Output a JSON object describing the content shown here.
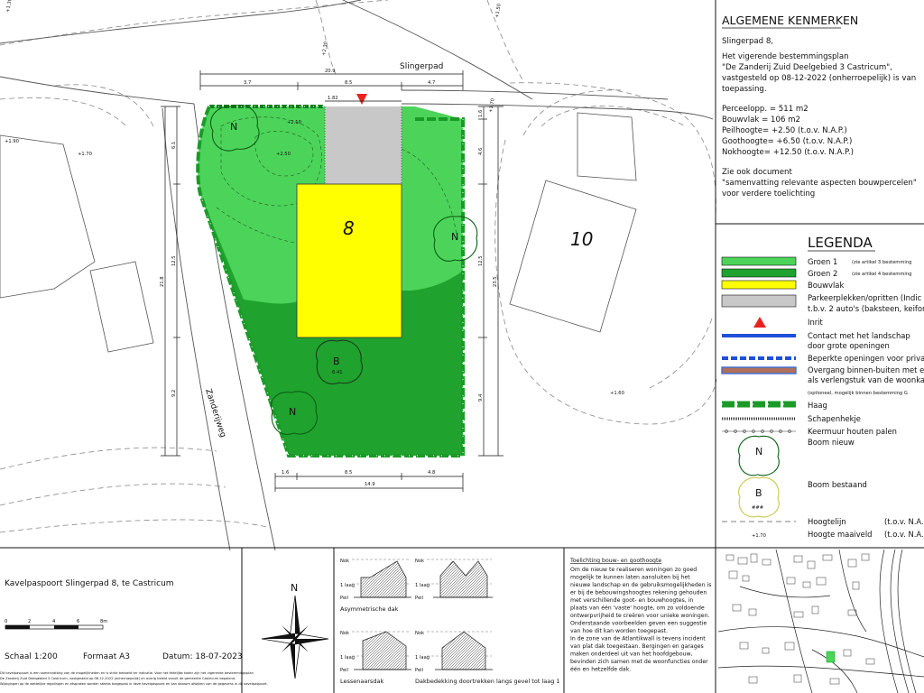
{
  "plan": {
    "street_label": "Slingerpad",
    "road_label": "Zanderijweg",
    "plot_number": "8",
    "neighbor_number": "10",
    "tree_new_letter": "N",
    "tree_existing_letter": "B",
    "tree_existing_height": "6.41",
    "dims_top": [
      "20.9",
      "3.7",
      "8.5",
      "4.7"
    ],
    "dim_182": "1.82",
    "dims_bottom": [
      "1.6",
      "8.5",
      "4.8",
      "14.9"
    ],
    "dims_left": [
      "6.1",
      "12.5",
      "21.8",
      "9.2"
    ],
    "dims_right": [
      "1.6",
      "4.6",
      "12.5",
      "23.5",
      "9.4"
    ],
    "contour_labels": [
      "+2.10",
      "+2.50"
    ],
    "spot_heights": [
      "+1.90",
      "+1.70",
      "+1.60"
    ],
    "rotated_heights": [
      "+1.30",
      "+2.30",
      "+1.50",
      "+1.70"
    ]
  },
  "kenmerken": {
    "title": "ALGEMENE KENMERKEN",
    "address": "Slingerpad 8,",
    "plan_lines": [
      "Het vigerende bestemmingsplan",
      "\"De Zanderij Zuid Deelgebied 3 Castricum\",",
      "vastgesteld op 08-12-2022 (onherroepelijk) is van",
      "toepassing."
    ],
    "values": [
      "Perceelopp. = 511 m2",
      "Bouwvlak = 106 m2",
      "Peilhoogte= +2.50 (t.o.v. N.A.P.)",
      "Goothoogte= +6.50 (t.o.v. N.A.P.)",
      "Nokhoogte= +12.50 (t.o.v. N.A.P.)"
    ],
    "doc_lines": [
      "Zie ook document",
      "\"samenvatting relevante aspecten bouwpercelen\"",
      "voor verdere toelichting"
    ]
  },
  "legenda": {
    "title": "LEGENDA",
    "items": [
      {
        "label": "Groen 1",
        "note": "(zie artikel 3 bestemming"
      },
      {
        "label": "Groen 2",
        "note": "(zie artikel 4 bestemming"
      },
      {
        "label": "Bouwvlak",
        "note": ""
      },
      {
        "label": "Parkeerplekken/opritten (Indic",
        "note": ""
      },
      {
        "label": "t.b.v. 2 auto's (baksteen, keiforma",
        "note": ""
      },
      {
        "label": "Inrit",
        "note": ""
      },
      {
        "label": "Contact met het landschap",
        "note": ""
      },
      {
        "label": "door grote openingen",
        "note": ""
      },
      {
        "label": "Beperkte openingen voor priva",
        "note": ""
      },
      {
        "label": "Overgang binnen-buiten met een",
        "note": ""
      },
      {
        "label": "als verlengstuk van de woonkam",
        "note": ""
      },
      {
        "label": "(optioneel, mogelijk binnen bestemming G",
        "note": ""
      },
      {
        "label": "Haag",
        "note": ""
      },
      {
        "label": "Schapenhekje",
        "note": ""
      },
      {
        "label": "Keermuur houten palen",
        "note": ""
      },
      {
        "label": "Boom nieuw",
        "note": ""
      },
      {
        "label": "Boom bestaand",
        "note": ""
      },
      {
        "label": "Hoogtelijn",
        "note": "(t.o.v. N.A.P"
      },
      {
        "label": "Hoogte maaiveld",
        "note": "(t.o.v. N.A.P"
      }
    ],
    "tree_height_sample": "###",
    "spot_sample": "+1.70"
  },
  "colors": {
    "groen1": "#4cd45a",
    "groen2": "#1fa32e",
    "bouwvlak": "#ffff00",
    "parkeer": "#c8c8c8",
    "inrit": "#e8231e",
    "contact": "#1e4fd8",
    "overgang": "#b0705a"
  },
  "footer": {
    "title": "Kavelpaspoort Slingerpad 8, te Castricum",
    "scale_ticks": [
      "0",
      "2",
      "4",
      "6",
      "8m"
    ],
    "scale": "Schaal 1:200",
    "format": "Formaat A3",
    "date": "Datum: 18-07-2023",
    "north": "N",
    "disclaimer": [
      "Dit kavelpaspoort is een samenvatting van de mogelijkheden en is strikt bedoeld ter indicatie. Voor het feitelijke kader zijn het vigerende bestemmingsplan",
      "De Zanderij Zuid Deelgebied 3 Castricum, vastgesteld op 08-12-2022 (onherroepelijk) en overig beleid vanuit de gemeente Castricum bepalend.",
      "Wijzigingen op de wettelijke regelingen en afspraken worden steeds toegepast in deze kavelpaspoort en kan daarom afwijken van de gegevens in dit kavelpaspoort."
    ],
    "roofs": {
      "nok": "Nok",
      "tlaag": "1 laag",
      "peil": "Peil",
      "asym": "Asymmetrische dak",
      "lessenaar": "Lessenaarsdak",
      "dakbedekking": "Dakbedekking doortrekken langs gevel tot laag 1"
    },
    "toelichting_title": "Toelichting bouw- en goothoogte",
    "toelichting": [
      "Om de nieuw te realiseren woningen zo goed",
      "mogelijk te kunnen laten aansluiten bij het",
      "nieuwe landschap en de gebruiksmogelijkheden is",
      "er bij de bebouwingshoogtes rekening gehouden",
      "met verschillende goot- en bouwhoogtes, in",
      "plaats van één 'vaste' hoogte, om zo voldoende",
      "ontwerpvrijheid te creëren voor unieke woningen.",
      "Onderstaande voorbeelden geven een suggestie",
      "van hoe dit kan worden toegepast.",
      "In de zone van de Atlantikwall is tevens incident",
      "van plat dak toegestaan. Bergingen en garages",
      "maken onderdeel uit van het hoofdgebouw,",
      "bevinden zich samen met de woonfuncties onder",
      "één en hetzelfde dak."
    ]
  }
}
